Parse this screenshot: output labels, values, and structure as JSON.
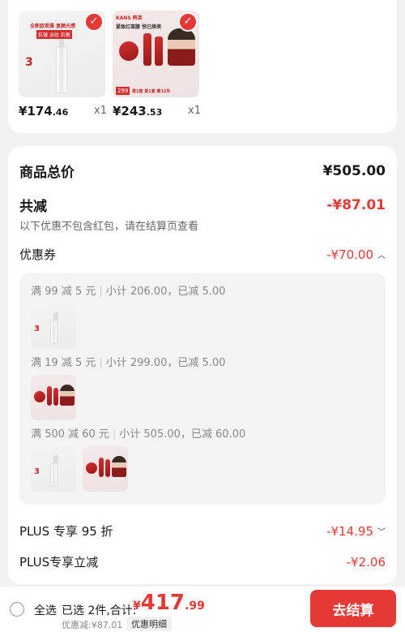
{
  "products": [
    {
      "price_int": "¥174",
      "price_dec": ".46",
      "qty": "x1",
      "img_text": {
        "title": "全新欧莱雅 复颜光感",
        "tags": "抗皱 淡纹 抗氧",
        "badge": "3"
      }
    },
    {
      "price_int": "¥243",
      "price_dec": ".53",
      "qty": "x1",
      "img_text": {
        "brand": "KANS 韩束",
        "title": "紧致红蛮腰 悦已焕美",
        "promo": "299",
        "promo_text": "第1套 第1套 拿12件"
      }
    }
  ],
  "summary": {
    "total_label": "商品总价",
    "total_value": "¥505.00",
    "reduce_label": "共减",
    "reduce_value": "-¥87.01",
    "hint": "以下优惠不包含红包，请在结算页查看",
    "coupon_label": "优惠券",
    "coupon_value": "-¥70.00",
    "coupon_rules": [
      {
        "rule": "满 99 减 5 元",
        "detail": "小计 206.00，已减 5.00"
      },
      {
        "rule": "满 19 减 5 元",
        "detail": "小计 299.00，已减 5.00"
      },
      {
        "rule": "满 500 减 60 元",
        "detail": "小计 505.00，已减 60.00"
      }
    ],
    "plus_discount_label": "PLUS 专享 95 折",
    "plus_discount_value": "-¥14.95",
    "plus_reduce_label": "PLUS专享立减",
    "plus_reduce_value": "-¥2.06"
  },
  "bottom_bar": {
    "select_all": "全选",
    "selected": "已选 2件,合计:",
    "total_currency": "¥",
    "total_int": "417",
    "total_dec": ".99",
    "discount": "优惠减:¥87.01",
    "detail_button": "优惠明细",
    "checkout_button": "去结算"
  },
  "colors": {
    "accent": "#e53935",
    "background": "#f2f2f2",
    "card": "#ffffff"
  }
}
